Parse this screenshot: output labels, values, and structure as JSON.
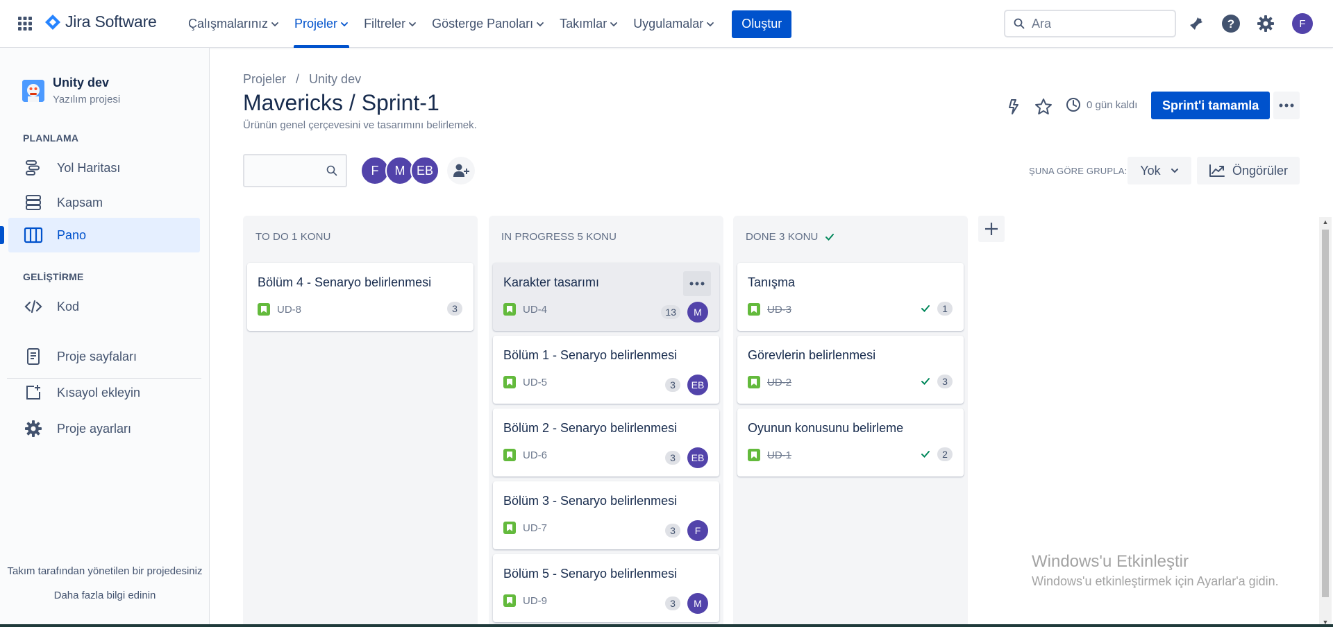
{
  "topnav": {
    "logo_text": "Jira Software",
    "items": [
      {
        "label": "Çalışmalarınız",
        "active": false
      },
      {
        "label": "Projeler",
        "active": true
      },
      {
        "label": "Filtreler",
        "active": false
      },
      {
        "label": "Gösterge Panoları",
        "active": false
      },
      {
        "label": "Takımlar",
        "active": false
      },
      {
        "label": "Uygulamalar",
        "active": false
      }
    ],
    "create_label": "Oluştur",
    "search_placeholder": "Ara",
    "user_initial": "F"
  },
  "sidebar": {
    "project_name": "Unity dev",
    "project_type": "Yazılım projesi",
    "planning_label": "PLANLAMA",
    "planning_items": [
      {
        "label": "Yol Haritası",
        "icon": "roadmap-icon"
      },
      {
        "label": "Kapsam",
        "icon": "backlog-icon"
      },
      {
        "label": "Pano",
        "icon": "board-icon",
        "active": true
      }
    ],
    "dev_label": "GELİŞTİRME",
    "dev_items": [
      {
        "label": "Kod",
        "icon": "code-icon"
      }
    ],
    "other_items": [
      {
        "label": "Proje sayfaları",
        "icon": "pages-icon"
      },
      {
        "label": "Kısayol ekleyin",
        "icon": "add-shortcut-icon"
      },
      {
        "label": "Proje ayarları",
        "icon": "gear-icon"
      }
    ],
    "footer_text": "Takım tarafından yönetilen bir projedesiniz",
    "footer_link": "Daha fazla bilgi edinin"
  },
  "header": {
    "breadcrumb": [
      "Projeler",
      "/",
      "Unity dev"
    ],
    "title": "Mavericks / Sprint-1",
    "subtitle": "Ürünün genel çerçevesini ve tasarımını belirlemek.",
    "days_left": "0 gün kaldı",
    "complete_label": "Sprint'i tamamla"
  },
  "toolbar": {
    "avatars": [
      "F",
      "M",
      "EB"
    ],
    "group_label": "ŞUNA GÖRE GRUPLA:",
    "group_value": "Yok",
    "insights_label": "Öngörüler"
  },
  "columns": [
    {
      "title": "TO DO 1 KONU",
      "done_check": false,
      "cards": [
        {
          "title": "Bölüm 4 - Senaryo belirlenmesi",
          "key": "UD-8",
          "points": "3",
          "assignee": "",
          "done": false
        }
      ]
    },
    {
      "title": "IN PROGRESS 5 KONU",
      "done_check": false,
      "cards": [
        {
          "title": "Karakter tasarımı",
          "key": "UD-4",
          "points": "13",
          "assignee": "M",
          "done": false
        },
        {
          "title": "Bölüm 1 - Senaryo belirlenmesi",
          "key": "UD-5",
          "points": "3",
          "assignee": "EB",
          "done": false
        },
        {
          "title": "Bölüm 2 - Senaryo belirlenmesi",
          "key": "UD-6",
          "points": "3",
          "assignee": "EB",
          "done": false
        },
        {
          "title": "Bölüm 3 - Senaryo belirlenmesi",
          "key": "UD-7",
          "points": "3",
          "assignee": "F",
          "done": false
        },
        {
          "title": "Bölüm 5 - Senaryo belirlenmesi",
          "key": "UD-9",
          "points": "3",
          "assignee": "M",
          "done": false
        }
      ]
    },
    {
      "title": "DONE 3 KONU",
      "done_check": true,
      "cards": [
        {
          "title": "Tanışma",
          "key": "UD-3",
          "points": "1",
          "assignee": "",
          "done": true
        },
        {
          "title": "Görevlerin belirlenmesi",
          "key": "UD-2",
          "points": "3",
          "assignee": "",
          "done": true
        },
        {
          "title": "Oyunun konusunu belirleme",
          "key": "UD-1",
          "points": "2",
          "assignee": "",
          "done": true
        }
      ]
    }
  ],
  "watermark": {
    "title": "Windows'u Etkinleştir",
    "subtitle": "Windows'u etkinleştirmek için Ayarlar'a gidin."
  },
  "colors": {
    "brand": "#0052cc",
    "avatar": "#5243aa",
    "story": "#63ba3c",
    "done_check": "#00875a"
  }
}
